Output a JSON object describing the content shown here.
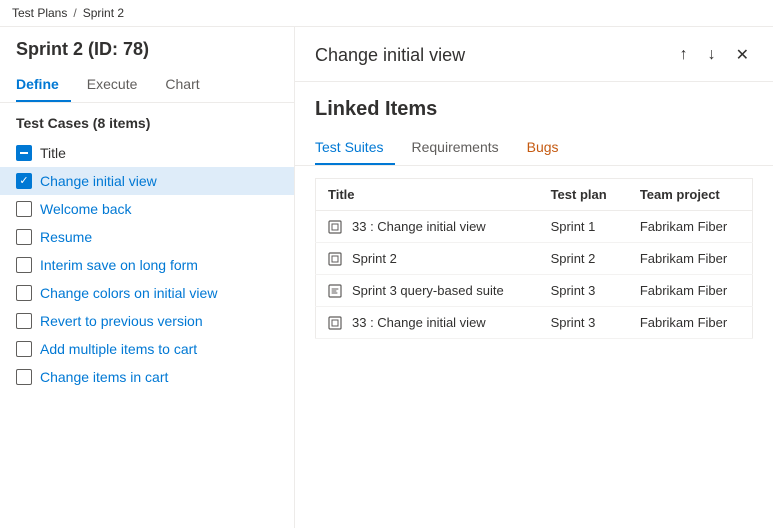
{
  "breadcrumb": {
    "part1": "Test Plans",
    "separator": "/",
    "part2": "Sprint 2"
  },
  "leftPanel": {
    "sprintTitle": "Sprint 2 (ID: 78)",
    "tabs": [
      {
        "label": "Define",
        "active": true
      },
      {
        "label": "Execute",
        "active": false
      },
      {
        "label": "Chart",
        "active": false
      }
    ],
    "testCasesHeader": "Test Cases (8 items)",
    "titleLabel": "Title",
    "items": [
      {
        "label": "Change initial view",
        "selected": true,
        "checked": true
      },
      {
        "label": "Welcome back",
        "selected": false,
        "checked": false
      },
      {
        "label": "Resume",
        "selected": false,
        "checked": false
      },
      {
        "label": "Interim save on long form",
        "selected": false,
        "checked": false
      },
      {
        "label": "Change colors on initial view",
        "selected": false,
        "checked": false
      },
      {
        "label": "Revert to previous version",
        "selected": false,
        "checked": false
      },
      {
        "label": "Add multiple items to cart",
        "selected": false,
        "checked": false
      },
      {
        "label": "Change items in cart",
        "selected": false,
        "checked": false
      }
    ]
  },
  "rightPanel": {
    "panelTitle": "Change initial view",
    "linkedItemsTitle": "Linked Items",
    "tabs": [
      {
        "label": "Test Suites",
        "active": true
      },
      {
        "label": "Requirements",
        "active": false
      },
      {
        "label": "Bugs",
        "active": false,
        "orange": true
      }
    ],
    "table": {
      "columns": [
        "Title",
        "Test plan",
        "Team project"
      ],
      "rows": [
        {
          "icon": "suite",
          "title": "33 : Change initial view",
          "testPlan": "Sprint 1",
          "teamProject": "Fabrikam Fiber"
        },
        {
          "icon": "suite",
          "title": "Sprint 2",
          "testPlan": "Sprint 2",
          "teamProject": "Fabrikam Fiber"
        },
        {
          "icon": "query-suite",
          "title": "Sprint 3 query-based suite",
          "testPlan": "Sprint 3",
          "teamProject": "Fabrikam Fiber"
        },
        {
          "icon": "suite",
          "title": "33 : Change initial view",
          "testPlan": "Sprint 3",
          "teamProject": "Fabrikam Fiber"
        }
      ]
    }
  }
}
